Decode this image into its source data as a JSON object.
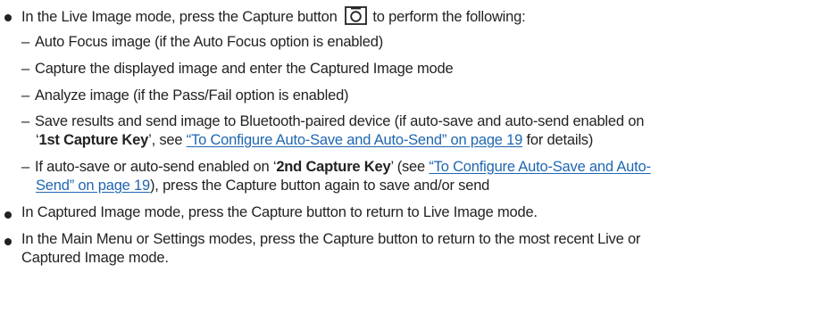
{
  "items": [
    {
      "text_before_icon": "In the Live Image mode, press the Capture button",
      "icon": "camera-icon",
      "text_after_icon": " to perform the following:",
      "subitems": [
        {
          "dash": "–",
          "text": "Auto Focus image (if the Auto Focus option is enabled)"
        },
        {
          "dash": "–",
          "text": "Capture the displayed image and enter the Captured Image mode"
        },
        {
          "dash": "–",
          "text": "Analyze image (if the Pass/Fail option is enabled)"
        },
        {
          "dash": "–",
          "line1": "Save results and send image to Bluetooth-paired device (if auto-save and auto-send enabled on",
          "line2_pre": "‘",
          "line2_bold": "1st Capture Key",
          "line2_mid": "’, see ",
          "line2_link": "“To Configure Auto-Save and Auto-Send” on page 19",
          "line2_post": " for details)"
        },
        {
          "dash": "–",
          "line1_pre": "If auto-save or auto-send enabled on ‘",
          "line1_bold": "2nd Capture Key",
          "line1_mid": "’ (see ",
          "line1_link": "“To Configure Auto-Save and Auto-",
          "line2_link": "Send” on page 19",
          "line2_post": "), press the Capture button again to save and/or send"
        }
      ]
    },
    {
      "text": "In Captured Image mode, press the Capture button to return to Live Image mode."
    },
    {
      "line1": "In the Main Menu or Settings modes, press the Capture button to return to the most recent Live or",
      "line2": "Captured Image mode."
    }
  ],
  "colors": {
    "text": "#222222",
    "link": "#1f66b0"
  }
}
